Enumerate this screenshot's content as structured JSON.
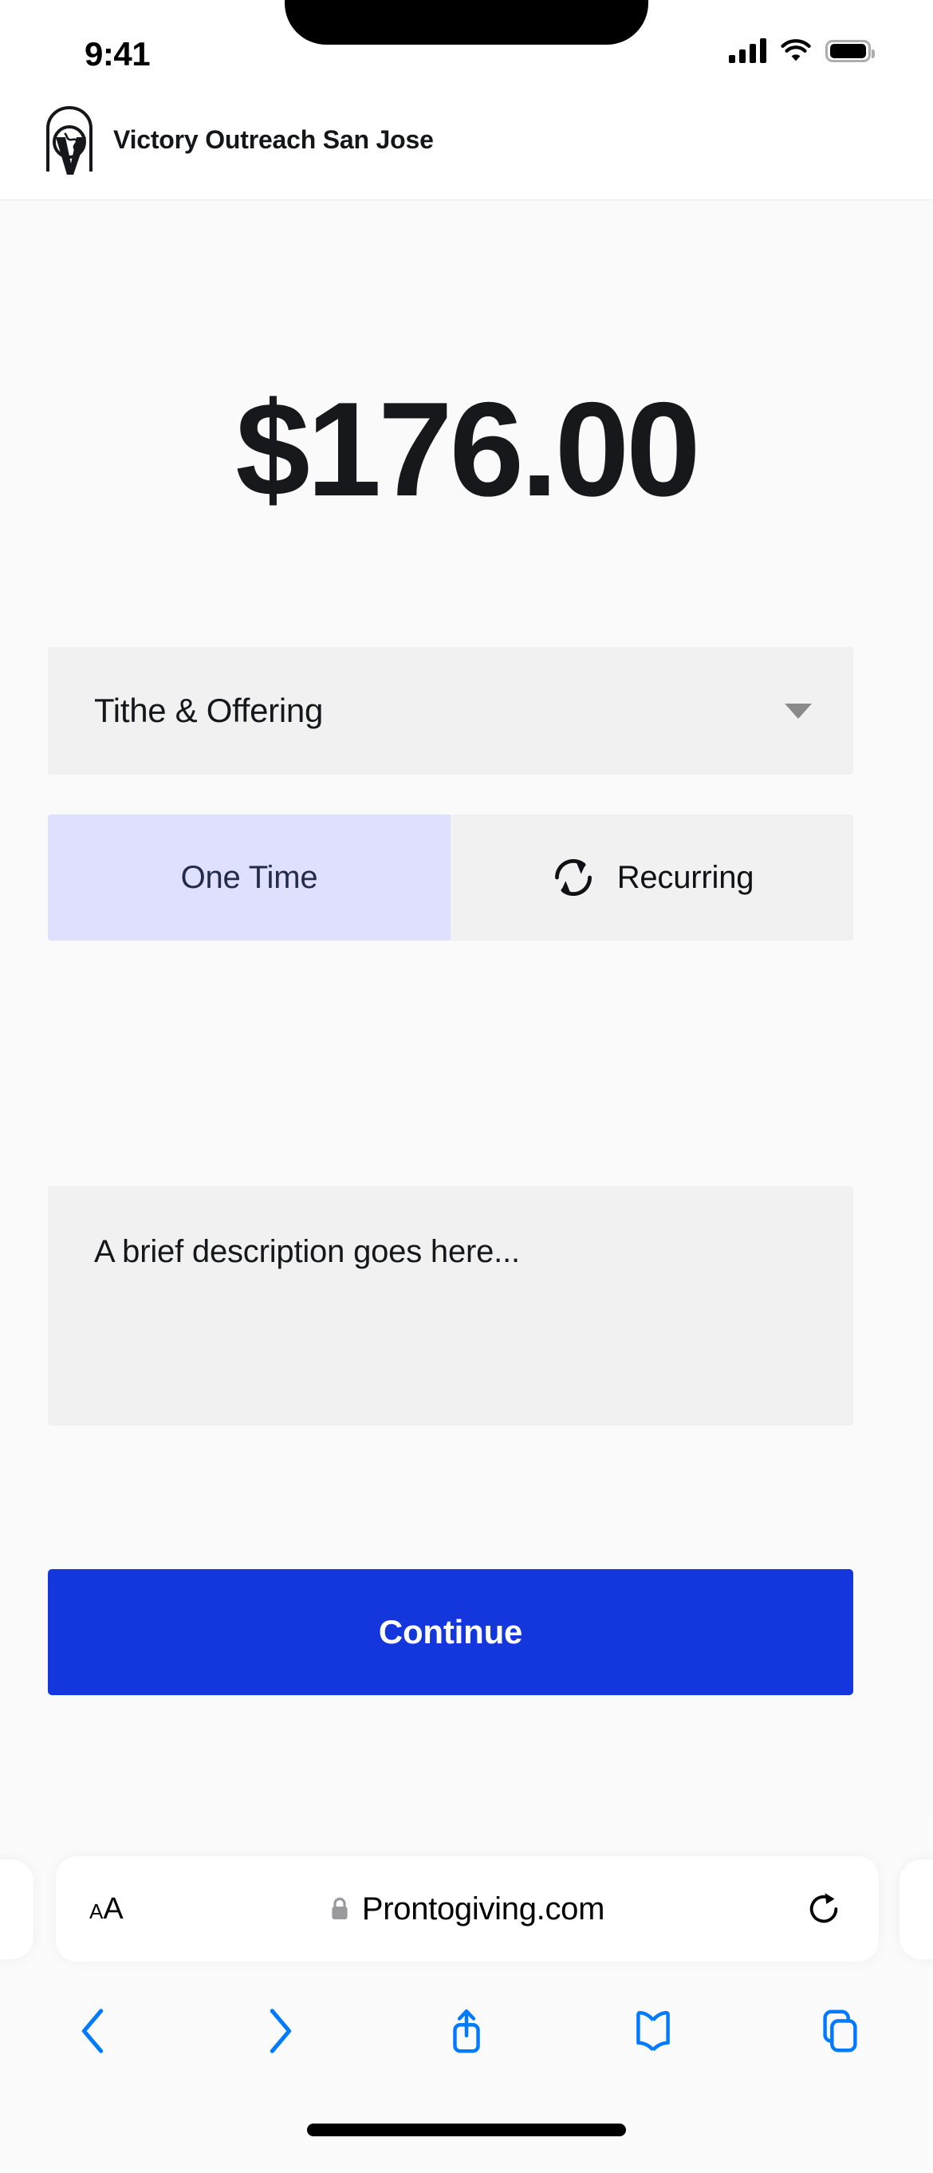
{
  "status_bar": {
    "time": "9:41",
    "cellular_icon": "signal-bars-icon",
    "cellular_bars_filled": 4,
    "wifi_icon": "wifi-icon",
    "battery_icon": "battery-full-icon"
  },
  "site_header": {
    "logo_icon": "church-arch-globe-logo",
    "org_name": "Victory Outreach San Jose"
  },
  "donation_form": {
    "amount": "$176.00",
    "fund_select": {
      "value": "Tithe & Offering",
      "caret_icon": "chevron-down-icon"
    },
    "frequency": {
      "selected": "One Time",
      "options": [
        {
          "label": "One Time",
          "icon": null,
          "active": true
        },
        {
          "label": "Recurring",
          "icon": "recurring-arrows-icon",
          "active": false
        }
      ]
    },
    "description": {
      "value": "A brief description goes here...",
      "placeholder": "A brief description goes here..."
    },
    "continue_label": "Continue"
  },
  "browser": {
    "text_size_small": "A",
    "text_size_large": "A",
    "text_size_icon": "text-size-icon",
    "lock_icon": "lock-icon",
    "url": "Prontogiving.com",
    "reload_icon": "reload-icon",
    "toolbar": [
      {
        "name": "back",
        "icon": "chevron-left-icon"
      },
      {
        "name": "forward",
        "icon": "chevron-right-icon"
      },
      {
        "name": "share",
        "icon": "share-icon"
      },
      {
        "name": "bookmarks",
        "icon": "book-icon"
      },
      {
        "name": "tabs",
        "icon": "tabs-icon"
      }
    ]
  },
  "colors": {
    "accent_blue": "#1336dd",
    "active_tab_bg": "#dfe0fd",
    "field_bg": "#f1f1f1",
    "page_bg": "#fafafa",
    "ios_blue": "#007aff"
  }
}
